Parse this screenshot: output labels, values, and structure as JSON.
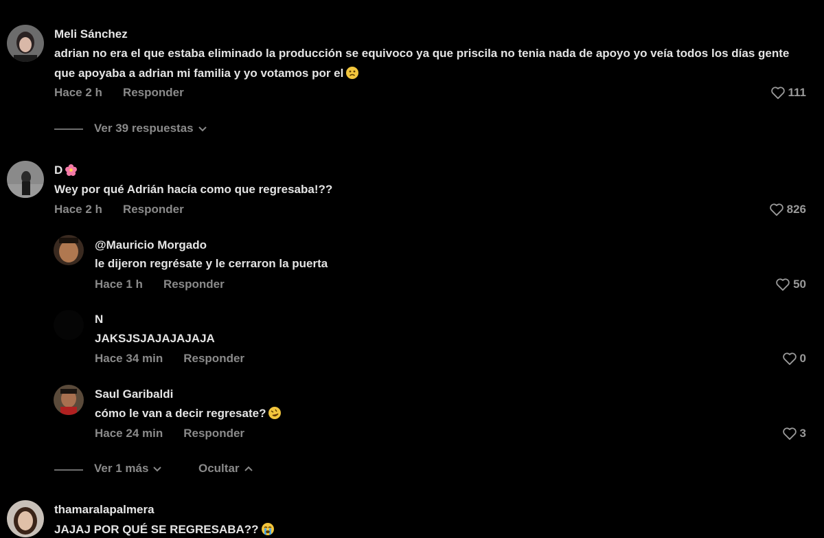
{
  "comments": [
    {
      "username": "Meli Sánchez",
      "text": "adrian no era el que estaba eliminado la producción se equivoco ya que priscila no tenia nada de apoyo yo veía todos los días gente que apoyaba a adrian mi familia y yo votamos por el",
      "time": "Hace 2 h",
      "reply_label": "Responder",
      "likes": "111",
      "view_replies": "Ver 39 respuestas"
    },
    {
      "username": "D",
      "text": "Wey por qué Adrián hacía como que regresaba!??",
      "time": "Hace 2 h",
      "reply_label": "Responder",
      "likes": "826",
      "replies": [
        {
          "username": "@Mauricio Morgado",
          "text": "le dijeron regrésate y le cerraron la puerta",
          "time": "Hace 1 h",
          "reply_label": "Responder",
          "likes": "50"
        },
        {
          "username": "N",
          "text": "JAKSJSJAJAJAJAJA",
          "time": "Hace 34 min",
          "reply_label": "Responder",
          "likes": "0"
        },
        {
          "username": "Saul Garibaldi",
          "text": "cómo le van a decir regresate?",
          "time": "Hace 24 min",
          "reply_label": "Responder",
          "likes": "3"
        }
      ],
      "view_more": "Ver 1 más",
      "hide": "Ocultar"
    },
    {
      "username": "thamaralapalmera",
      "text": "JAJAJ POR QUÉ SE REGRESABA??"
    }
  ]
}
